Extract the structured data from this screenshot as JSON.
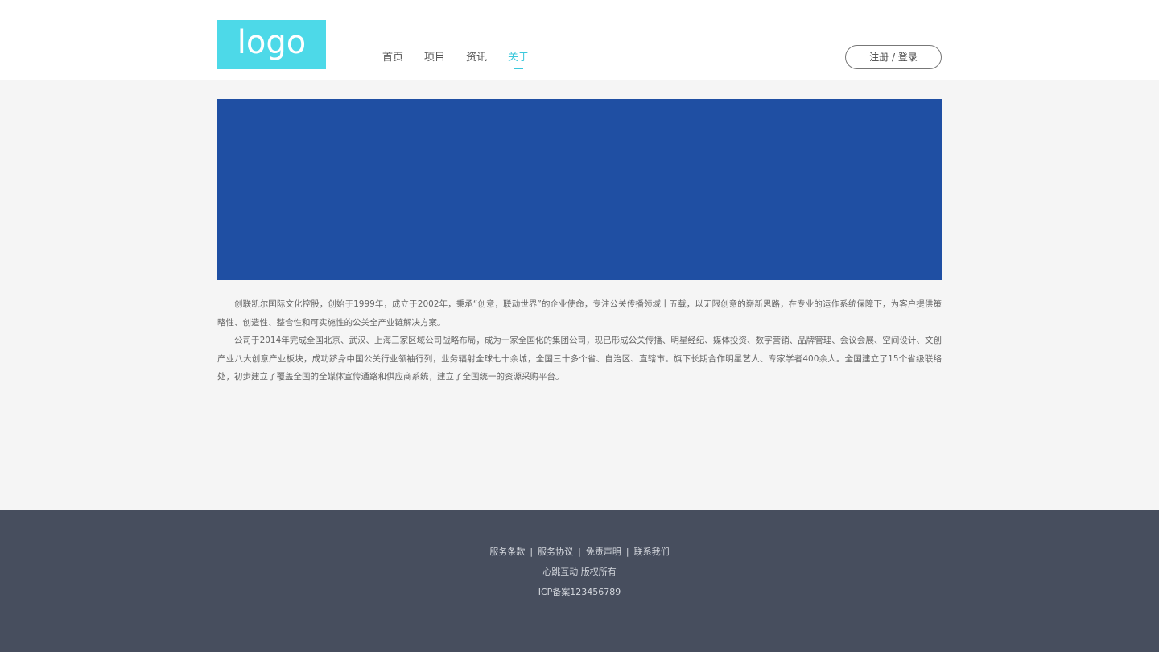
{
  "header": {
    "logo_text": "logo",
    "nav": [
      {
        "label": "首页",
        "active": false
      },
      {
        "label": "项目",
        "active": false
      },
      {
        "label": "资讯",
        "active": false
      },
      {
        "label": "关于",
        "active": true
      }
    ],
    "auth_label": "注册 / 登录"
  },
  "banner": {
    "color": "#1f4fa3"
  },
  "content": {
    "paragraphs": [
      "创联凯尔国际文化控股，创始于1999年，成立于2002年，秉承“创意，联动世界”的企业使命，专注公关传播领域十五载，以无限创意的崭新思路，在专业的运作系统保障下，为客户提供策略性、创造性、整合性和可实施性的公关全产业链解决方案。",
      "公司于2014年完成全国北京、武汉、上海三家区域公司战略布局，成为一家全国化的集团公司，现已形成公关传播、明星经纪、媒体投资、数字营销、品牌管理、会议会展、空间设计、文创产业八大创意产业板块，成功跻身中国公关行业领袖行列，业务辐射全球七十余城，全国三十多个省、自治区、直辖市。旗下长期合作明星艺人、专家学者400余人。全国建立了15个省级联络处，初步建立了覆盖全国的全媒体宣传通路和供应商系统，建立了全国统一的资源采购平台。"
    ]
  },
  "footer": {
    "links": [
      "服务条款",
      "服务协议",
      "免责声明",
      "联系我们"
    ],
    "separator": "|",
    "copyright": "心跳互动 版权所有",
    "icp": "ICP备案123456789"
  },
  "colors": {
    "accent": "#3cc8dc",
    "logo_bg": "#4dd9e8",
    "footer_bg": "#474e5e",
    "page_bg": "#f5f5f5"
  }
}
